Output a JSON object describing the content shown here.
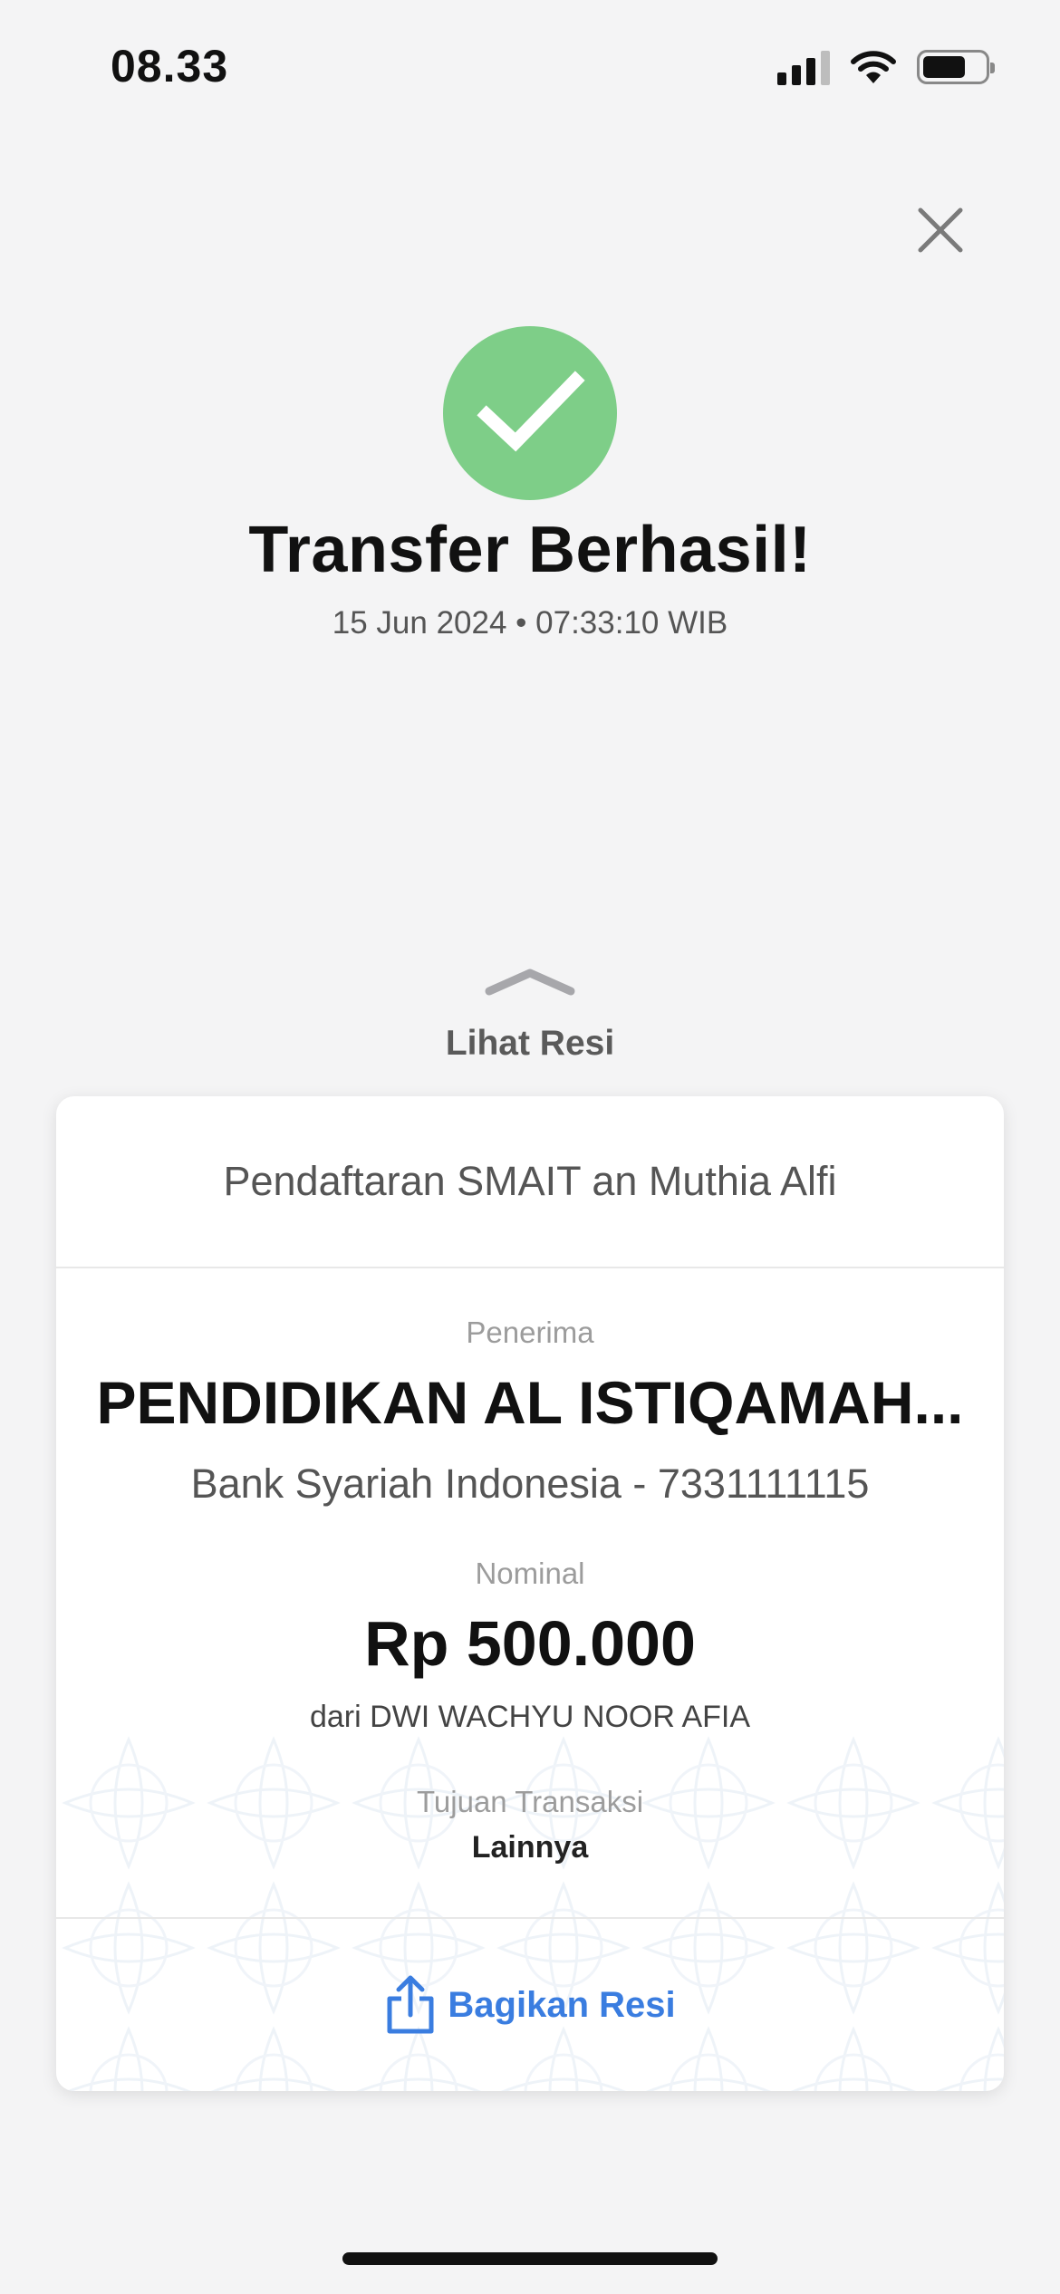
{
  "status_bar": {
    "time": "08.33",
    "icons": [
      "cellular-signal-icon",
      "wifi-icon",
      "battery-icon"
    ]
  },
  "header": {
    "close_icon": "close-icon",
    "success_icon": "checkmark-icon",
    "title": "Transfer Berhasil!",
    "datetime": "15 Jun 2024 • 07:33:10 WIB"
  },
  "receipt_toggle": {
    "icon": "chevron-up-icon",
    "label": "Lihat Resi"
  },
  "receipt": {
    "note": "Pendaftaran SMAIT an Muthia Alfi",
    "recipient_label": "Penerima",
    "recipient_name": "PENDIDIKAN AL ISTIQAMAH...",
    "recipient_bank": "Bank Syariah Indonesia - 7331111115",
    "amount_label": "Nominal",
    "amount": "Rp 500.000",
    "sender": "dari DWI WACHYU NOOR AFIA",
    "purpose_label": "Tujuan Transaksi",
    "purpose_value": "Lainnya",
    "share_icon": "share-icon",
    "share_label": "Bagikan Resi"
  },
  "colors": {
    "success_green": "#7ece88",
    "accent_blue": "#3a7de0",
    "background": "#f4f4f5"
  }
}
